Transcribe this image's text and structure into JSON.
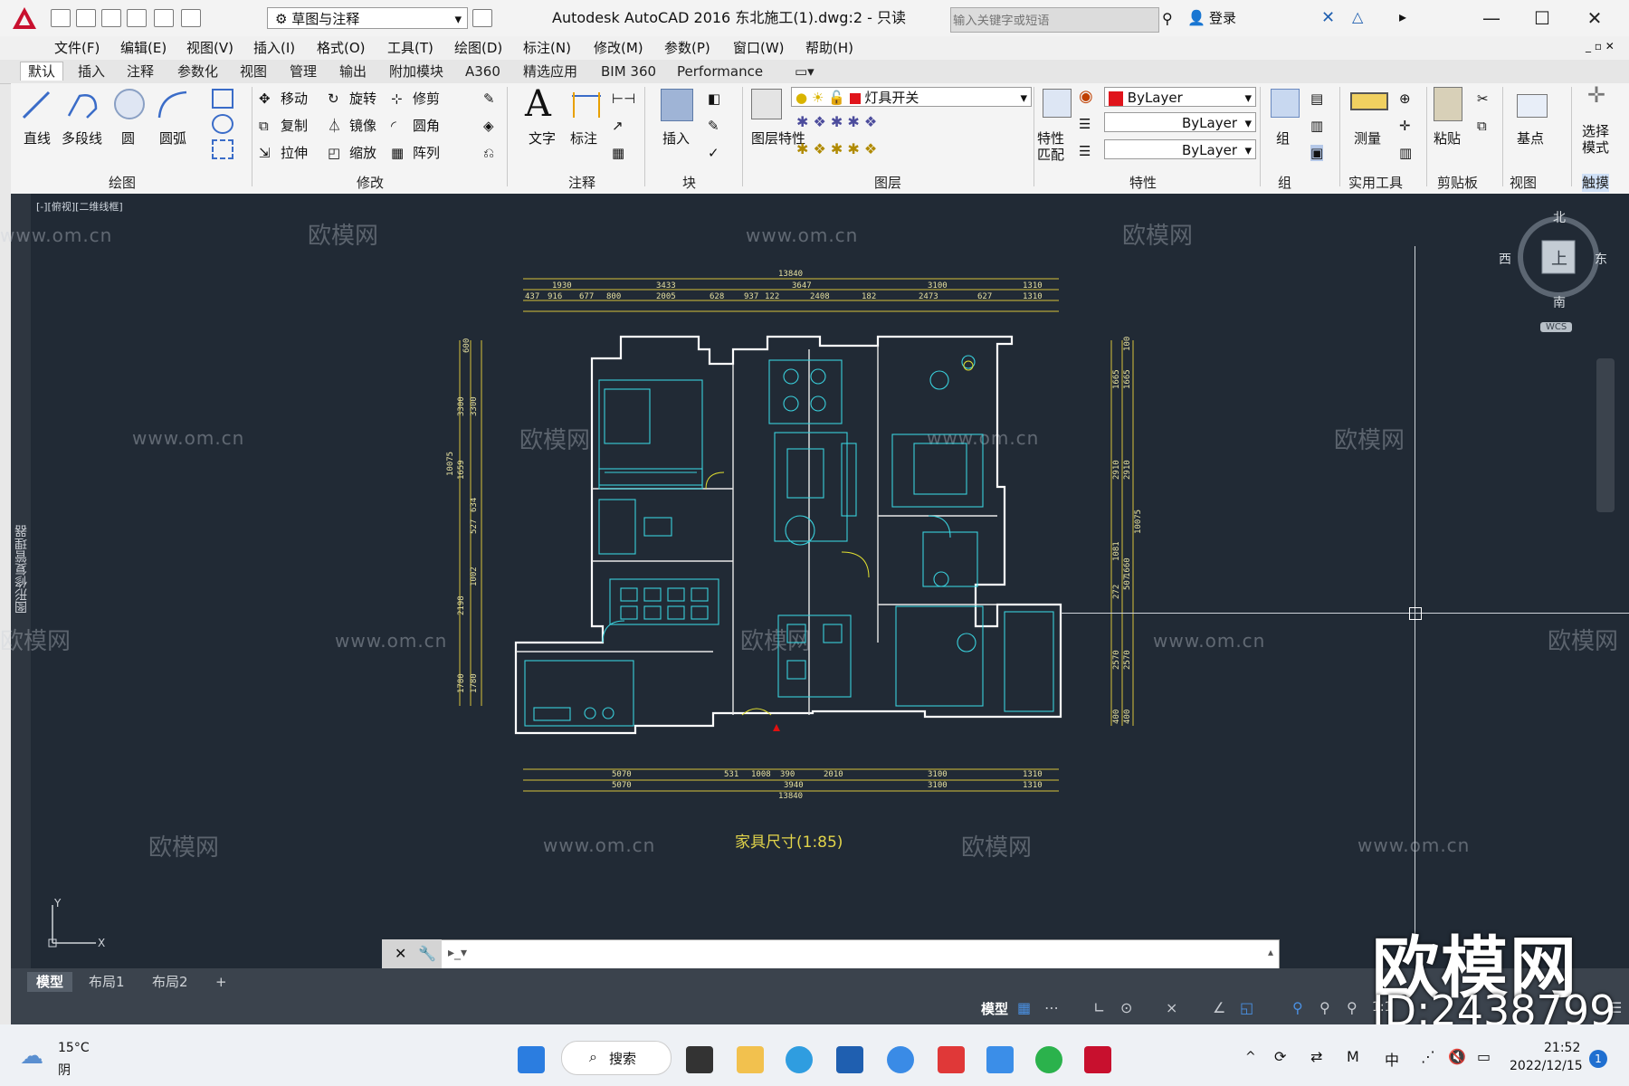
{
  "title_bar": {
    "workspace": "草图与注释",
    "window_title": "Autodesk AutoCAD 2016    东北施工(1).dwg:2 - 只读",
    "search_placeholder": "输入关键字或短语",
    "login": "登录"
  },
  "menu": [
    "文件(F)",
    "编辑(E)",
    "视图(V)",
    "插入(I)",
    "格式(O)",
    "工具(T)",
    "绘图(D)",
    "标注(N)",
    "修改(M)",
    "参数(P)",
    "窗口(W)",
    "帮助(H)"
  ],
  "ribbon_tabs": [
    "默认",
    "插入",
    "注释",
    "参数化",
    "视图",
    "管理",
    "输出",
    "附加模块",
    "A360",
    "精选应用",
    "BIM 360",
    "Performance"
  ],
  "ribbon": {
    "draw": {
      "title": "绘图",
      "tools": [
        "直线",
        "多段线",
        "圆",
        "圆弧"
      ]
    },
    "modify": {
      "title": "修改",
      "tools": [
        "移动",
        "旋转",
        "修剪",
        "复制",
        "镜像",
        "圆角",
        "拉伸",
        "缩放",
        "阵列"
      ]
    },
    "annotation": {
      "title": "注释",
      "tools": [
        "文字",
        "标注"
      ]
    },
    "block": {
      "title": "块",
      "tools": [
        "插入"
      ]
    },
    "layers": {
      "title": "图层",
      "layer_props": "图层特性",
      "current_layer": "灯具开关"
    },
    "properties": {
      "title": "特性",
      "match": "特性匹配",
      "color": "ByLayer",
      "linetype": "ByLayer",
      "lineweight": "ByLayer"
    },
    "groups": {
      "title": "组",
      "label": "组"
    },
    "utilities": {
      "title": "实用工具",
      "label": "测量"
    },
    "clipboard": {
      "title": "剪贴板",
      "label": "粘贴"
    },
    "view": {
      "title": "视图",
      "label": "基点"
    },
    "touch": {
      "title": "触摸",
      "label": "选择模式"
    }
  },
  "drawing": {
    "viewport_label": "[-][俯视][二维线框]",
    "caption": "家具尺寸(1:85)",
    "dims_top_total": "13840",
    "dims_top": [
      "1930",
      "3433",
      "3647",
      "3100",
      "1310"
    ],
    "dims_top_sub": [
      "437",
      "916",
      "677",
      "800",
      "2005",
      "628",
      "937",
      "122",
      "2408",
      "182",
      "2473",
      "627",
      "1310"
    ],
    "dims_bottom": [
      "5070",
      "531",
      "1008",
      "390",
      "2010",
      "3100",
      "1310"
    ],
    "dims_bottom2": [
      "5070",
      "3940",
      "3100",
      "1310"
    ],
    "dims_bottom_total": "13840",
    "dims_left": [
      "600",
      "3300",
      "3300",
      "634",
      "527",
      "1659",
      "1002",
      "2198",
      "1780",
      "1780"
    ],
    "dims_left_total": "10075",
    "dims_right": [
      "100",
      "1665",
      "1665",
      "2910",
      "2910",
      "1081",
      "1660",
      "272",
      "507",
      "2570",
      "2570",
      "400",
      "400"
    ],
    "dims_right_total": "10075"
  },
  "viewcube": {
    "north": "北",
    "south": "南",
    "east": "东",
    "west": "西",
    "top": "上",
    "wcs": "WCS"
  },
  "palette_label": "图形修复管理器",
  "watermark": {
    "brand": "欧模网",
    "url": "www.om.cn",
    "big": "欧模网",
    "id": "ID:2438799"
  },
  "layout_tabs": [
    "模型",
    "布局1",
    "布局2"
  ],
  "status": {
    "model": "模型",
    "scale": "1:1"
  },
  "taskbar": {
    "temp": "15°C",
    "weather": "阴",
    "search": "搜索",
    "time": "21:52",
    "date": "2022/12/15",
    "ime": "中"
  }
}
